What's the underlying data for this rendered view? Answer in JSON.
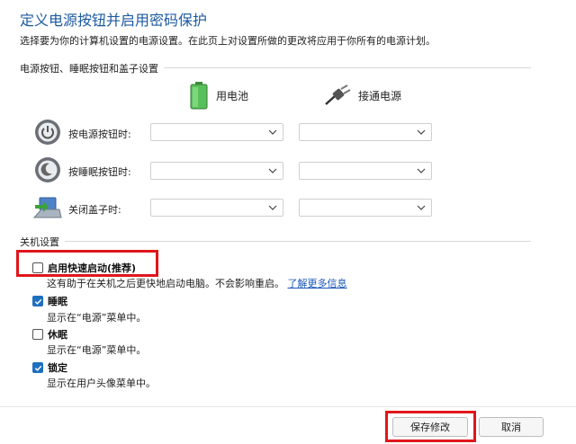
{
  "page": {
    "title": "定义电源按钮并启用密码保护",
    "subtitle": "选择要为你的计算机设置的电源设置。在此页上对设置所做的更改将应用于你所有的电源计划。"
  },
  "power_section": {
    "label": "电源按钮、睡眠按钮和盖子设置",
    "col_battery": "用电池",
    "col_plugged": "接通电源",
    "rows": [
      {
        "label": "按电源按钮时:",
        "icon": "power-button-icon"
      },
      {
        "label": "按睡眠按钮时:",
        "icon": "sleep-button-icon"
      },
      {
        "label": "关闭盖子时:",
        "icon": "laptop-lid-icon"
      }
    ]
  },
  "shutdown_section": {
    "label": "关机设置",
    "options": [
      {
        "label": "启用快速启动(推荐)",
        "checked": false,
        "desc": "这有助于在关机之后更快地启动电脑。不会影响重启。",
        "link": "了解更多信息"
      },
      {
        "label": "睡眠",
        "checked": true,
        "desc": "显示在“电源”菜单中。"
      },
      {
        "label": "休眠",
        "checked": false,
        "desc": "显示在“电源”菜单中。"
      },
      {
        "label": "锁定",
        "checked": true,
        "desc": "显示在用户头像菜单中。"
      }
    ]
  },
  "footer": {
    "save_label": "保存修改",
    "cancel_label": "取消"
  },
  "colors": {
    "title": "#1c5aa0",
    "accent": "#1f6fbf",
    "highlight": "#e0161b"
  }
}
